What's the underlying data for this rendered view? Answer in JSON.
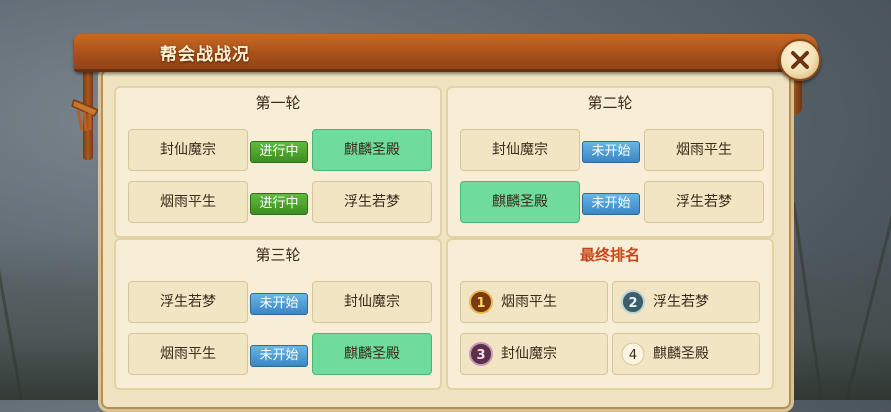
{
  "window": {
    "title": "帮会战战况"
  },
  "rounds": [
    {
      "title": "第一轮",
      "matches": [
        {
          "left": "封仙魔宗",
          "status": "进行中",
          "right": "麒麟圣殿"
        },
        {
          "left": "烟雨平生",
          "status": "进行中",
          "right": "浮生若梦"
        }
      ]
    },
    {
      "title": "第二轮",
      "matches": [
        {
          "left": "封仙魔宗",
          "status": "未开始",
          "right": "烟雨平生"
        },
        {
          "left": "麒麟圣殿",
          "status": "未开始",
          "right": "浮生若梦"
        }
      ]
    },
    {
      "title": "第三轮",
      "matches": [
        {
          "left": "浮生若梦",
          "status": "未开始",
          "right": "封仙魔宗"
        },
        {
          "left": "烟雨平生",
          "status": "未开始",
          "right": "麒麟圣殿"
        }
      ]
    }
  ],
  "ranking": {
    "title": "最终排名",
    "entries": [
      {
        "rank": "1",
        "name": "烟雨平生"
      },
      {
        "rank": "2",
        "name": "浮生若梦"
      },
      {
        "rank": "3",
        "name": "封仙魔宗"
      },
      {
        "rank": "4",
        "name": "麒麟圣殿"
      }
    ]
  },
  "colors": {
    "title_bar": "#b65a1e",
    "panel_bg": "#efe3c1",
    "highlight_cell": "#6fdc9c",
    "status_active": "#4aa32e",
    "status_pending": "#4a97d4",
    "ranking_title": "#c8461a"
  },
  "icons": {
    "close": "close-x-icon",
    "rank1": "rank-1-medal-icon",
    "rank2": "rank-2-medal-icon",
    "rank3": "rank-3-medal-icon",
    "rank4": "rank-4-plain-icon"
  }
}
